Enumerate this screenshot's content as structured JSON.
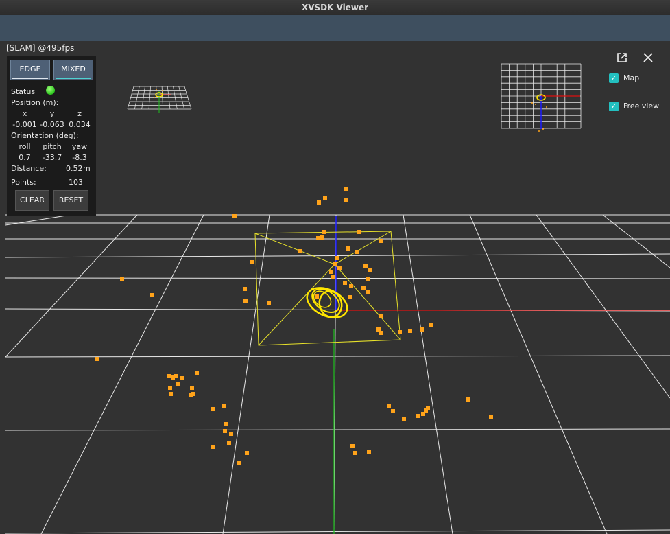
{
  "window": {
    "title": "XVSDK Viewer"
  },
  "viewport": {
    "fps_label": "[SLAM]  @495fps"
  },
  "modes": {
    "edge": "EDGE",
    "mixed": "MIXED",
    "active": "mixed"
  },
  "panel": {
    "status_label": "Status",
    "status_color": "#34d21c",
    "position_label": "Position (m):",
    "position_headers": [
      "x",
      "y",
      "z"
    ],
    "position_values": [
      "-0.001",
      "-0.063",
      "0.034"
    ],
    "orientation_label": "Orientation (deg):",
    "orientation_headers": [
      "roll",
      "pitch",
      "yaw"
    ],
    "orientation_values": [
      "0.7",
      "-33.7",
      "-8.3"
    ],
    "distance_label": "Distance:",
    "distance_value": "0.52",
    "distance_unit": "m",
    "points_label": "Points:",
    "points_value": "103",
    "clear_label": "CLEAR",
    "reset_label": "RESET"
  },
  "overlays": {
    "map_label": "Map",
    "map_checked": true,
    "free_view_label": "Free view",
    "free_view_checked": true,
    "popout_icon": "popout-icon",
    "close_icon": "close-icon"
  },
  "colors": {
    "accent": "#23c0c0",
    "points": "#ffa31a",
    "trajectory": "#ffe600",
    "frustum": "#e8e22a",
    "axis_x": "#e01010",
    "axis_y": "#1ec01e",
    "axis_z": "#1a1aff",
    "grid": "#e8e8e8"
  }
}
